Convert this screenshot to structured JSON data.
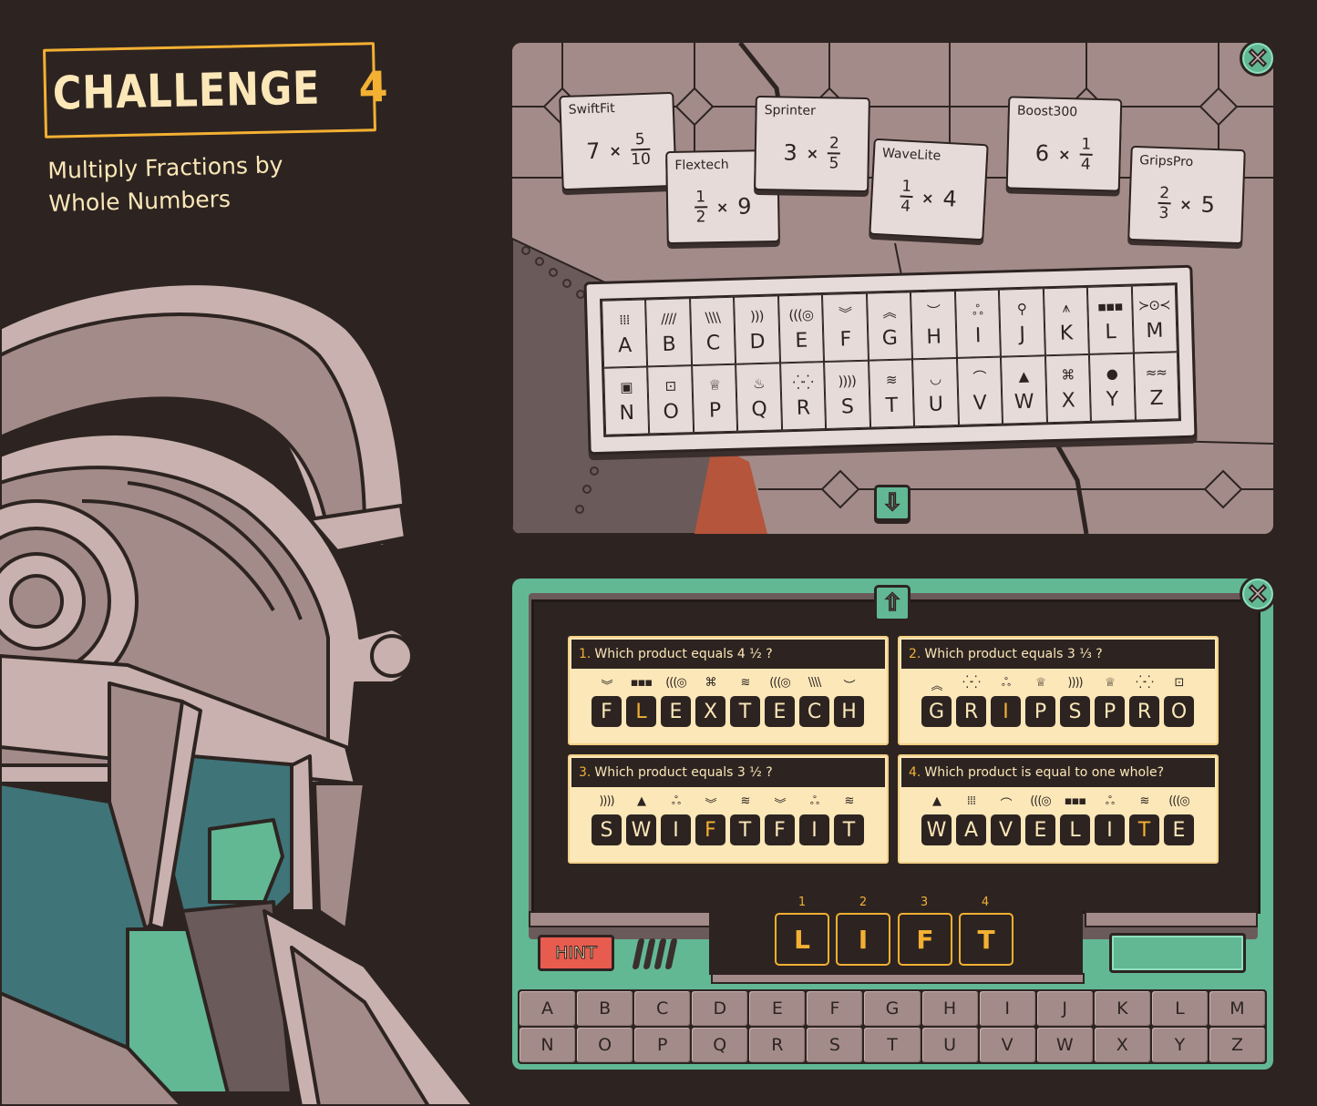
{
  "header": {
    "title_word": "CHALLENGE",
    "title_number": "4",
    "subtitle": "Multiply Fractions by Whole Numbers"
  },
  "colors": {
    "background": "#2d2421",
    "accent_gold": "#f3b033",
    "cream": "#fbe7b8",
    "stone": "#a38b89",
    "teal": "#62b893",
    "hint_red": "#e85b4f"
  },
  "top_panel": {
    "close_icon": "×",
    "down_arrow": "⇩",
    "cards": [
      {
        "name": "SwiftFit",
        "whole": "7",
        "num": "5",
        "den": "10",
        "order": "whole-first"
      },
      {
        "name": "Flextech",
        "whole": "9",
        "num": "1",
        "den": "2",
        "order": "frac-first"
      },
      {
        "name": "Sprinter",
        "whole": "3",
        "num": "2",
        "den": "5",
        "order": "whole-first"
      },
      {
        "name": "WaveLite",
        "whole": "4",
        "num": "1",
        "den": "4",
        "order": "frac-first"
      },
      {
        "name": "Boost300",
        "whole": "6",
        "num": "1",
        "den": "4",
        "order": "whole-first"
      },
      {
        "name": "GripsPro",
        "whole": "5",
        "num": "2",
        "den": "3",
        "order": "frac-first"
      }
    ],
    "times": "×",
    "cipher_legend": [
      {
        "letter": "A",
        "symbol": "⁞⁞⁞"
      },
      {
        "letter": "B",
        "symbol": "////"
      },
      {
        "letter": "C",
        "symbol": "\\\\\\\\"
      },
      {
        "letter": "D",
        "symbol": ")))"
      },
      {
        "letter": "E",
        "symbol": "(((◎"
      },
      {
        "letter": "F",
        "symbol": "︾"
      },
      {
        "letter": "G",
        "symbol": "︽"
      },
      {
        "letter": "H",
        "symbol": "︶"
      },
      {
        "letter": "I",
        "symbol": "ஃ"
      },
      {
        "letter": "J",
        "symbol": "⚲"
      },
      {
        "letter": "K",
        "symbol": "⩚"
      },
      {
        "letter": "L",
        "symbol": "▪▪▪"
      },
      {
        "letter": "M",
        "symbol": "≻⊙≺"
      },
      {
        "letter": "N",
        "symbol": "▣"
      },
      {
        "letter": "O",
        "symbol": "⊡"
      },
      {
        "letter": "P",
        "symbol": "♕"
      },
      {
        "letter": "Q",
        "symbol": "♨"
      },
      {
        "letter": "R",
        "symbol": "⁛⁛"
      },
      {
        "letter": "S",
        "symbol": "))))"
      },
      {
        "letter": "T",
        "symbol": "≋"
      },
      {
        "letter": "U",
        "symbol": "◡"
      },
      {
        "letter": "V",
        "symbol": "⌒"
      },
      {
        "letter": "W",
        "symbol": "▲"
      },
      {
        "letter": "X",
        "symbol": "⌘"
      },
      {
        "letter": "Y",
        "symbol": "●"
      },
      {
        "letter": "Z",
        "symbol": "≈≈"
      }
    ]
  },
  "bottom_panel": {
    "close_icon": "×",
    "up_arrow": "⇧",
    "questions": [
      {
        "number": "1.",
        "text": "Which product equals 4 ½ ?",
        "symbols": [
          "︾",
          "▪▪▪",
          "(((◎",
          "⌘",
          "≋",
          "(((◎",
          "\\\\\\\\",
          "︶"
        ],
        "letters": [
          "F",
          "L",
          "E",
          "X",
          "T",
          "E",
          "C",
          "H"
        ],
        "highlight_index": 1
      },
      {
        "number": "2.",
        "text": "Which product equals 3 ⅓ ?",
        "symbols": [
          "︽",
          "⁛⁛",
          "ஃ",
          "♕",
          "))))",
          "♕",
          "⁛⁛",
          "⊡"
        ],
        "letters": [
          "G",
          "R",
          "I",
          "P",
          "S",
          "P",
          "R",
          "O"
        ],
        "highlight_index": 2
      },
      {
        "number": "3.",
        "text": "Which product equals 3 ½ ?",
        "symbols": [
          "))))",
          "▲",
          "ஃ",
          "︾",
          "≋",
          "︾",
          "ஃ",
          "≋"
        ],
        "letters": [
          "S",
          "W",
          "I",
          "F",
          "T",
          "F",
          "I",
          "T"
        ],
        "highlight_index": 3
      },
      {
        "number": "4.",
        "text": "Which product is equal to one whole?",
        "symbols": [
          "▲",
          "⁞⁞⁞",
          "⌒",
          "(((◎",
          "▪▪▪",
          "ஃ",
          "≋",
          "(((◎"
        ],
        "letters": [
          "W",
          "A",
          "V",
          "E",
          "L",
          "I",
          "T",
          "E"
        ],
        "highlight_index": 6
      }
    ],
    "answer": {
      "numbers": [
        "1",
        "2",
        "3",
        "4"
      ],
      "letters": [
        "L",
        "I",
        "F",
        "T"
      ]
    },
    "hint_label": "HINT",
    "status_value": "",
    "keyboard": [
      "A",
      "B",
      "C",
      "D",
      "E",
      "F",
      "G",
      "H",
      "I",
      "J",
      "K",
      "L",
      "M",
      "N",
      "O",
      "P",
      "Q",
      "R",
      "S",
      "T",
      "U",
      "V",
      "W",
      "X",
      "Y",
      "Z"
    ]
  }
}
